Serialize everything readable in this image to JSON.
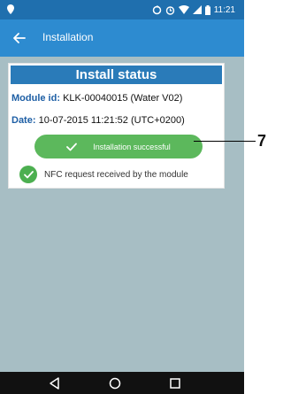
{
  "status_bar": {
    "time": "11:21",
    "icons": [
      "location-pin-icon",
      "sync-icon",
      "alarm-icon",
      "wifi-icon",
      "signal-icon",
      "battery-icon"
    ]
  },
  "app_bar": {
    "title": "Installation",
    "back_icon": "back-arrow-icon"
  },
  "card": {
    "header": "Install status",
    "module_label": "Module id:",
    "module_value": "KLK-00040015 (Water V02)",
    "date_label": "Date:",
    "date_value": "10-07-2015 11:21:52 (UTC+0200)",
    "success_button": "Installation successful",
    "nfc_text": "NFC request received by the module"
  },
  "callout": {
    "label": "7"
  },
  "nav_bar": {
    "buttons": [
      "back-triangle-icon",
      "home-circle-icon",
      "recents-square-icon"
    ]
  },
  "colors": {
    "status_bar": "#1f6fae",
    "app_bar": "#2d8bd0",
    "card_header": "#2a7bb9",
    "label_blue": "#1e5fa5",
    "success_green": "#5cb85c",
    "screen_background": "#a7bec4"
  }
}
